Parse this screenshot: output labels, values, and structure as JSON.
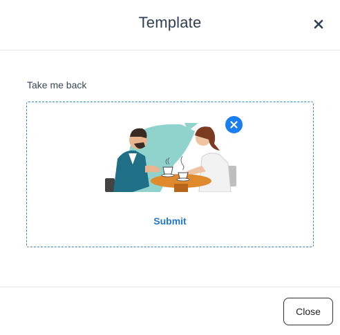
{
  "modal": {
    "title": "Template",
    "close_icon": "close-icon"
  },
  "form": {
    "label": "Take me back",
    "upload": {
      "preview_alt": "Illustration of a man and woman having coffee at a table",
      "remove_icon": "close-circle-icon",
      "submit_label": "Submit"
    }
  },
  "footer": {
    "close_label": "Close"
  },
  "colors": {
    "accent": "#1a7ef0",
    "link": "#1f78d1",
    "dashed_border": "#3b7fc4",
    "divider": "#e3e6ea"
  }
}
